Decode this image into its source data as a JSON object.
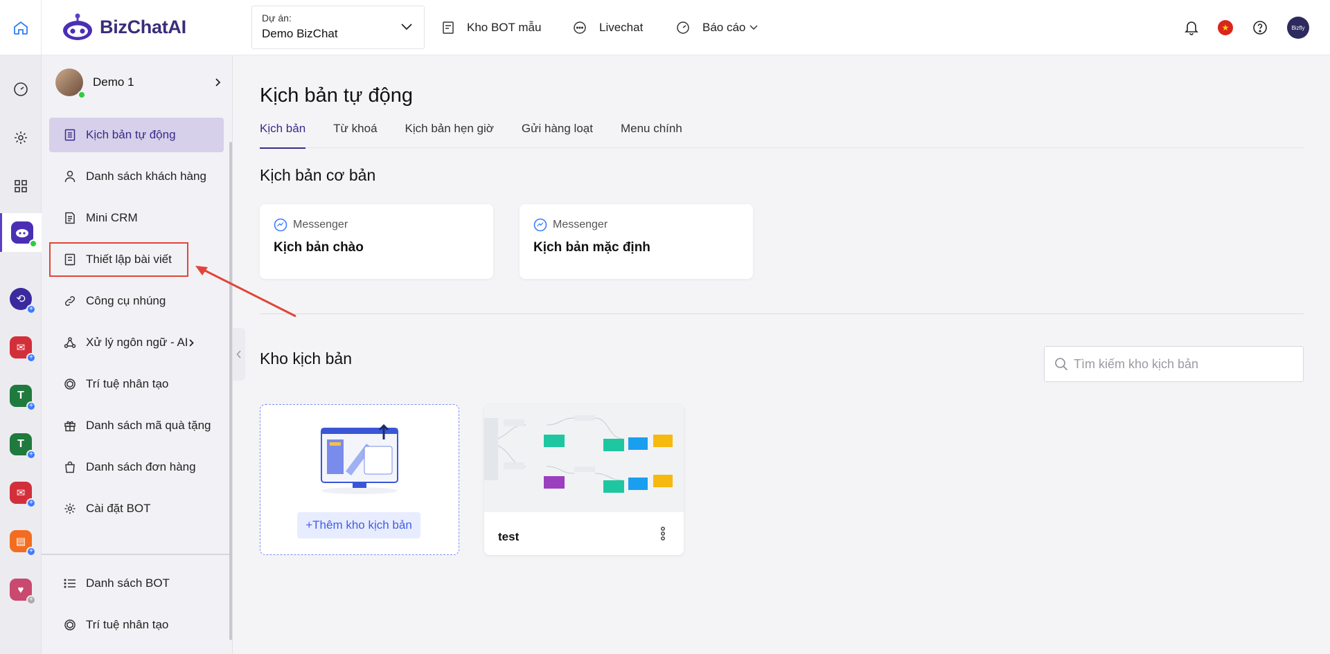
{
  "header": {
    "logo_text": "BizChatAI",
    "project_label": "Dự án:",
    "project_value": "Demo BizChat",
    "nav": [
      {
        "label": "Kho BOT mẫu"
      },
      {
        "label": "Livechat"
      },
      {
        "label": "Báo cáo"
      }
    ]
  },
  "sidebar": {
    "bot_name": "Demo 1",
    "items": [
      {
        "label": "Kịch bản tự động"
      },
      {
        "label": "Danh sách khách hàng"
      },
      {
        "label": "Mini CRM"
      },
      {
        "label": "Thiết lập bài viết"
      },
      {
        "label": "Công cụ nhúng"
      },
      {
        "label": "Xử lý ngôn ngữ - AI"
      },
      {
        "label": "Trí tuệ nhân tạo"
      },
      {
        "label": "Danh sách mã quà tặng"
      },
      {
        "label": "Danh sách đơn hàng"
      },
      {
        "label": "Cài đặt BOT"
      }
    ],
    "bottom_items": [
      {
        "label": "Danh sách BOT"
      },
      {
        "label": "Trí tuệ nhân tạo"
      }
    ]
  },
  "main": {
    "title": "Kịch bản tự động",
    "tabs": [
      {
        "label": "Kịch bản"
      },
      {
        "label": "Từ khoá"
      },
      {
        "label": "Kịch bản hẹn giờ"
      },
      {
        "label": "Gửi hàng loạt"
      },
      {
        "label": "Menu chính"
      }
    ],
    "basic_section_title": "Kịch bản cơ bản",
    "basic_cards": [
      {
        "channel": "Messenger",
        "name": "Kịch bản chào"
      },
      {
        "channel": "Messenger",
        "name": "Kịch bản mặc định"
      }
    ],
    "library_section_title": "Kho kịch bản",
    "search_placeholder": "Tìm kiếm kho kịch bản",
    "add_button_label": "+Thêm kho kịch bản",
    "script_cards": [
      {
        "name": "test"
      }
    ]
  },
  "colors": {
    "brand": "#3b2a8a",
    "active_menu_bg": "#d6d0ea",
    "annotation_red": "#e0453a",
    "add_button_blue": "#3f5ee6"
  }
}
